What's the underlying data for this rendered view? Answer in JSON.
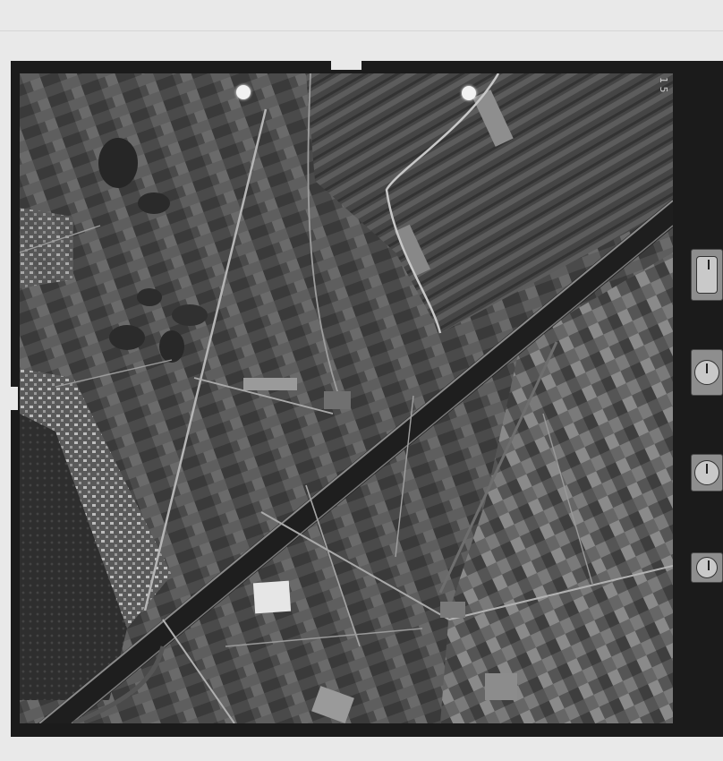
{
  "frame": {
    "number_label": "1 5"
  },
  "colors": {
    "film_border": "#1b1b1b",
    "page_background": "#e9e9e9",
    "fiducial": "#f2f2f2"
  },
  "instrument_panel": {
    "items": [
      "altimeter-gauge",
      "level-bubble",
      "clock-dial",
      "counter-dial"
    ]
  }
}
